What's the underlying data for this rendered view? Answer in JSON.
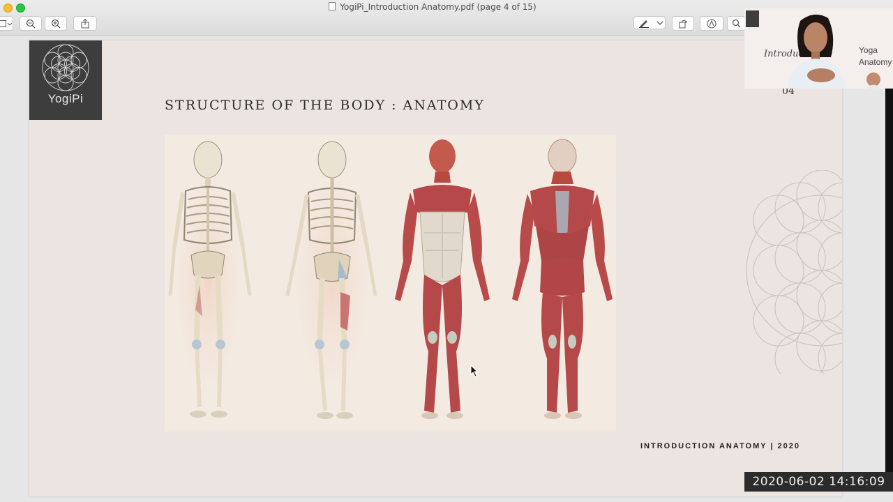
{
  "window": {
    "title": "YogiPi_Introduction Anatomy.pdf (page 4 of 15)"
  },
  "toolbar": {
    "sidebar_icon": "sidebar-toggle-icon",
    "zoom_out_icon": "zoom-out-icon",
    "zoom_in_icon": "zoom-in-icon",
    "share_icon": "share-icon",
    "markup_icon": "pen-icon",
    "rotate_icon": "rotate-icon",
    "annotate_icon": "markup-circle-icon",
    "search_icon": "search-icon"
  },
  "slide": {
    "logo_text": "YogiPi",
    "title": "STRUCTURE OF THE BODY : ANATOMY",
    "page_number": "04",
    "footer": "INTRODUCTION ANATOMY | 2020",
    "image_icon": "anatomy-illustration"
  },
  "webcam": {
    "overlay_intro": "Introduction",
    "overlay_yoga": "Yoga",
    "overlay_anatomy": "Anatomy"
  },
  "timestamp": "2020-06-02  14:16:09",
  "colors": {
    "page": "#ece4e1",
    "logo_bg": "#3d3d3d",
    "muscle": "#b5494a",
    "bone": "#eae3d2"
  }
}
